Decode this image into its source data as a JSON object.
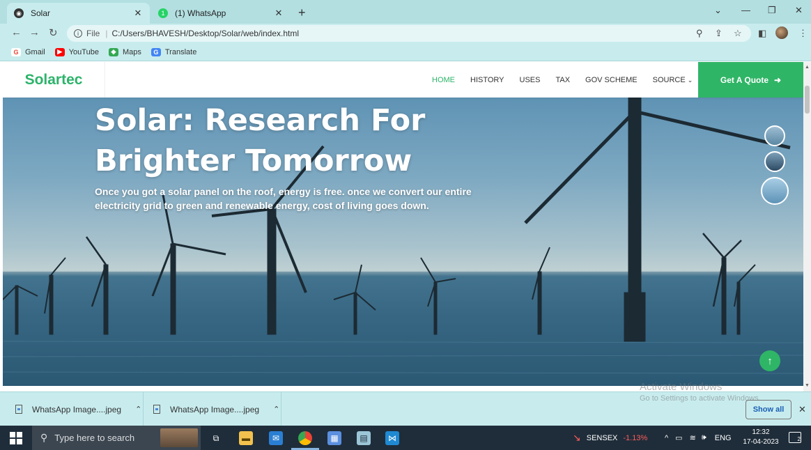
{
  "browser": {
    "tabs": [
      {
        "title": "Solar",
        "favicon": "chrome-page-icon",
        "active": true
      },
      {
        "title": "(1) WhatsApp",
        "favicon": "whatsapp-icon",
        "active": false
      }
    ],
    "address": {
      "scheme_label": "File",
      "url": "C:/Users/BHAVESH/Desktop/Solar/web/index.html"
    },
    "bookmarks": [
      {
        "label": "Gmail",
        "icon": "google-icon",
        "color": "#ea4335"
      },
      {
        "label": "YouTube",
        "icon": "youtube-icon",
        "color": "#ff0000"
      },
      {
        "label": "Maps",
        "icon": "maps-icon",
        "color": "#34a853"
      },
      {
        "label": "Translate",
        "icon": "translate-icon",
        "color": "#4285f4"
      }
    ]
  },
  "site": {
    "logo": "Solartec",
    "nav": [
      {
        "label": "HOME",
        "active": true
      },
      {
        "label": "HISTORY"
      },
      {
        "label": "USES"
      },
      {
        "label": "TAX"
      },
      {
        "label": "GOV SCHEME"
      },
      {
        "label": "SOURCE"
      }
    ],
    "cta": "Get A Quote",
    "accent": "#2fb566",
    "hero": {
      "title_line1": "Solar: Research For",
      "title_line2": "Brighter Tomorrow",
      "text": "Once you got a solar panel on the roof, energy is free. once we convert our entire electricity grid to green and renewable energy, cost of living goes down."
    }
  },
  "watermark": {
    "line1": "Activate Windows",
    "line2": "Go to Settings to activate Windows."
  },
  "downloads": {
    "items": [
      {
        "name": "WhatsApp Image....jpeg"
      },
      {
        "name": "WhatsApp Image....jpeg"
      }
    ],
    "show_all": "Show all"
  },
  "taskbar": {
    "search_placeholder": "Type here to search",
    "stock": {
      "name": "SENSEX",
      "change": "-1.13%",
      "color": "#ff5b5b"
    },
    "lang": "ENG",
    "time": "12:32",
    "date": "17-04-2023",
    "notifications": "2"
  }
}
